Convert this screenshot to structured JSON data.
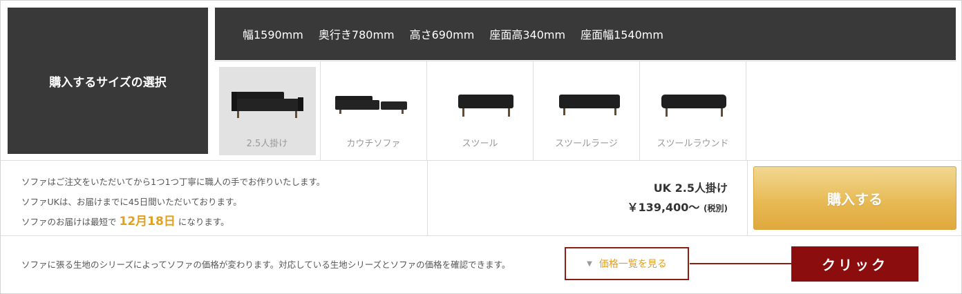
{
  "size_label": "購入するサイズの選択",
  "dimensions": [
    "幅1590mm",
    "奥行き780mm",
    "高さ690mm",
    "座面高340mm",
    "座面幅1540mm"
  ],
  "options": [
    {
      "label": "2.5人掛け",
      "icon": "sofa-icon",
      "selected": true
    },
    {
      "label": "カウチソファ",
      "icon": "couch-sofa-icon",
      "selected": false
    },
    {
      "label": "スツール",
      "icon": "stool-icon",
      "selected": false
    },
    {
      "label": "スツールラージ",
      "icon": "stool-large-icon",
      "selected": false
    },
    {
      "label": "スツールラウンド",
      "icon": "stool-round-icon",
      "selected": false
    }
  ],
  "delivery_note": {
    "line1": "ソファはご注文をいただいてから1つ1つ丁寧に職人の手でお作りいたします。",
    "line2": "ソファUKは、お届けまでに45日間いただいております。",
    "line3_prefix": "ソファのお届けは最短で",
    "date": "12月18日",
    "line3_suffix": "になります。"
  },
  "product": {
    "name": "UK 2.5人掛け",
    "price": "￥139,400〜",
    "tax_note": "(税別)"
  },
  "buy_button": "購入する",
  "fabric_note": "ソファに張る生地のシリーズによってソファの価格が変わります。対応している生地シリーズとソファの価格を確認できます。",
  "price_list_button": "価格一覧を見る",
  "callout": "クリック",
  "colors": {
    "dark_panel": "#393939",
    "accent_gold": "#e0a020",
    "callout_red": "#8b0d0d"
  }
}
